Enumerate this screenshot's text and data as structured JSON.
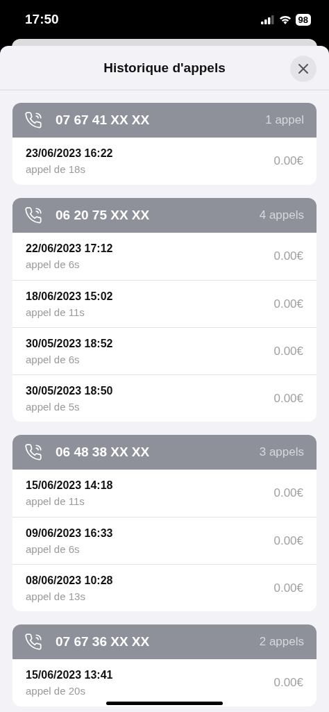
{
  "status_bar": {
    "time": "17:50",
    "battery": "98"
  },
  "sheet": {
    "title": "Historique d'appels"
  },
  "groups": [
    {
      "number": "07 67 41 XX XX",
      "count": "1 appel",
      "calls": [
        {
          "date": "23/06/2023 16:22",
          "duration": "appel de 18s",
          "price": "0.00€"
        }
      ]
    },
    {
      "number": "06 20 75 XX XX",
      "count": "4 appels",
      "calls": [
        {
          "date": "22/06/2023 17:12",
          "duration": "appel de 6s",
          "price": "0.00€"
        },
        {
          "date": "18/06/2023 15:02",
          "duration": "appel de 11s",
          "price": "0.00€"
        },
        {
          "date": "30/05/2023 18:52",
          "duration": "appel de 6s",
          "price": "0.00€"
        },
        {
          "date": "30/05/2023 18:50",
          "duration": "appel de 5s",
          "price": "0.00€"
        }
      ]
    },
    {
      "number": "06 48 38 XX XX",
      "count": "3 appels",
      "calls": [
        {
          "date": "15/06/2023 14:18",
          "duration": "appel de 11s",
          "price": "0.00€"
        },
        {
          "date": "09/06/2023 16:33",
          "duration": "appel de 6s",
          "price": "0.00€"
        },
        {
          "date": "08/06/2023 10:28",
          "duration": "appel de 13s",
          "price": "0.00€"
        }
      ]
    },
    {
      "number": "07 67 36 XX XX",
      "count": "2 appels",
      "calls": [
        {
          "date": "15/06/2023 13:41",
          "duration": "appel de 20s",
          "price": "0.00€"
        }
      ]
    }
  ]
}
